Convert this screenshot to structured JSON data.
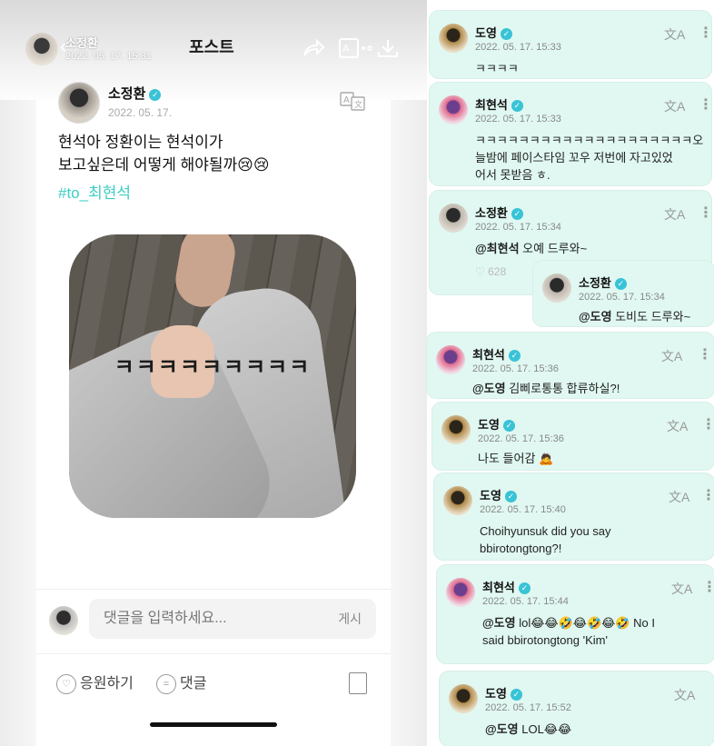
{
  "post": {
    "header": {
      "author": "소정환",
      "datetime": "2022. 05. 17. 15:31",
      "title": "포스트"
    },
    "author": "소정환",
    "date": "2022. 05. 17.",
    "body_line1": "현석아 정환이는 현석이가",
    "body_line2": "보고싶은데 어떻게 해야될까😢😢",
    "hashtag": "#to_최현석",
    "image_caption": "ㅋㅋㅋㅋㅋㅋㅋㅋㅋ",
    "comment_placeholder": "댓글을 입력하세요...",
    "comment_submit": "게시",
    "actions": {
      "cheer": "응원하기",
      "comment": "댓글"
    }
  },
  "comments": [
    {
      "name": "도영",
      "time": "2022. 05. 17. 15:33",
      "text": "ㅋㅋㅋㅋ"
    },
    {
      "name": "최현석",
      "time": "2022. 05. 17. 15:33",
      "line1": "ㅋㅋㅋㅋㅋㅋㅋㅋㅋㅋㅋㅋㅋㅋㅋㅋㅋㅋㅋㅋ오",
      "line2": "늘밤에 페이스타임 꼬우 저번에 자고있었",
      "line3": "어서 못받음 ㅎ."
    },
    {
      "name": "소정환",
      "time": "2022. 05. 17. 15:34",
      "mention": "@최현석",
      "text": " 오예 드루와~",
      "likes": "628"
    },
    {
      "name": "소정환",
      "time": "2022. 05. 17. 15:34",
      "mention": "@도영",
      "text": " 도비도 드루와~"
    },
    {
      "name": "최현석",
      "time": "2022. 05. 17. 15:36",
      "mention": "@도영",
      "text": " 김삐로통통 합류하실?!"
    },
    {
      "name": "도영",
      "time": "2022. 05. 17. 15:36",
      "text": "나도 들어감 🙇"
    },
    {
      "name": "도영",
      "time": "2022. 05. 17. 15:40",
      "line1": "Choihyunsuk did you say",
      "line2": "bbirotongtong?!"
    },
    {
      "name": "최현석",
      "time": "2022. 05. 17. 15:44",
      "mention": "@도영",
      "text": " lol😂😂🤣😂🤣😂🤣 No I",
      "line2": "said bbirotongtong 'Kim'"
    },
    {
      "name": "도영",
      "time": "2022. 05. 17. 15:52",
      "mention": "@도영",
      "text": " LOL😂😂"
    }
  ],
  "icons": {
    "verified": "verified-check-icon",
    "translate": "translate-icon",
    "more": "more-vertical-icon"
  },
  "colors": {
    "card_bg": "#e0f8f1",
    "verified": "#39c3d6",
    "hashtag": "#3ccfc3"
  }
}
